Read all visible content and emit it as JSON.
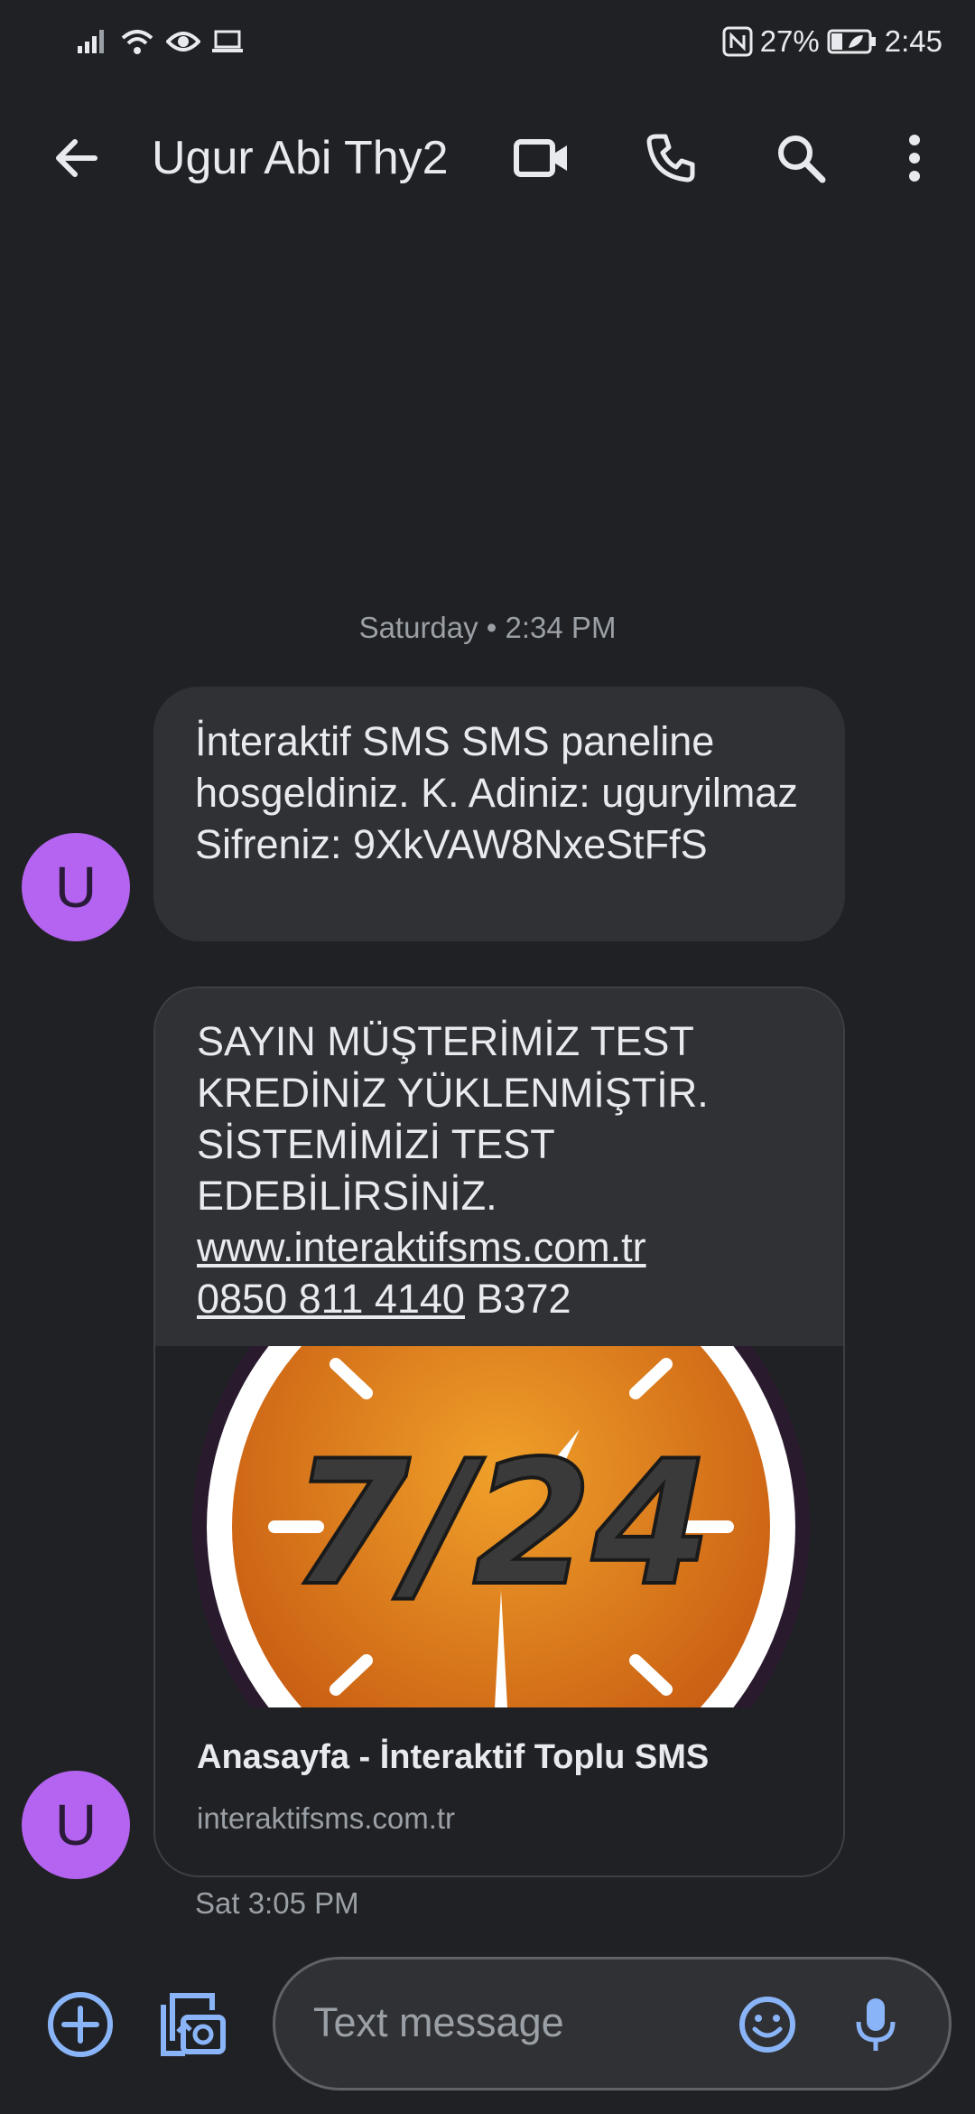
{
  "status_bar": {
    "battery": "27%",
    "time": "2:45",
    "icons": [
      "signal-icon",
      "wifi-icon",
      "eye-icon",
      "laptop-icon",
      "nfc-icon",
      "battery-icon"
    ]
  },
  "header": {
    "title": "Ugur Abi Thy2",
    "icons": [
      "back-arrow-icon",
      "video-call-icon",
      "phone-icon",
      "search-icon",
      "more-vert-icon"
    ]
  },
  "conversation": {
    "date_divider": "Saturday • 2:34 PM",
    "messages": [
      {
        "avatar": "U",
        "text": "İnteraktif SMS SMS paneline hosgeldiniz. K. Adiniz: uguryilmaz Sifreniz: 9XkVAW8NxeStFfS"
      },
      {
        "avatar": "U",
        "line1": "SAYIN MÜŞTERİMİZ TEST",
        "line2": "KREDİNİZ YÜKLENMİŞTİR.",
        "line3": "SİSTEMİMİZİ TEST",
        "line4": "EDEBİLİRSİNİZ.",
        "link": "www.interaktifsms.com.tr",
        "phone": "0850 811 4140",
        "suffix": " B372",
        "preview": {
          "image_text": "7/24",
          "title": "Anasayfa - İnteraktif Toplu SMS",
          "domain": "interaktifsms.com.tr"
        },
        "timestamp": "Sat 3:05 PM"
      }
    ]
  },
  "compose": {
    "placeholder": "Text message",
    "icons": [
      "add-icon",
      "gallery-camera-icon",
      "emoji-icon",
      "mic-icon"
    ]
  },
  "colors": {
    "background": "#202124",
    "bubble": "#303134",
    "avatar": "#b464f0",
    "accent_icon": "#8ab4f8"
  }
}
